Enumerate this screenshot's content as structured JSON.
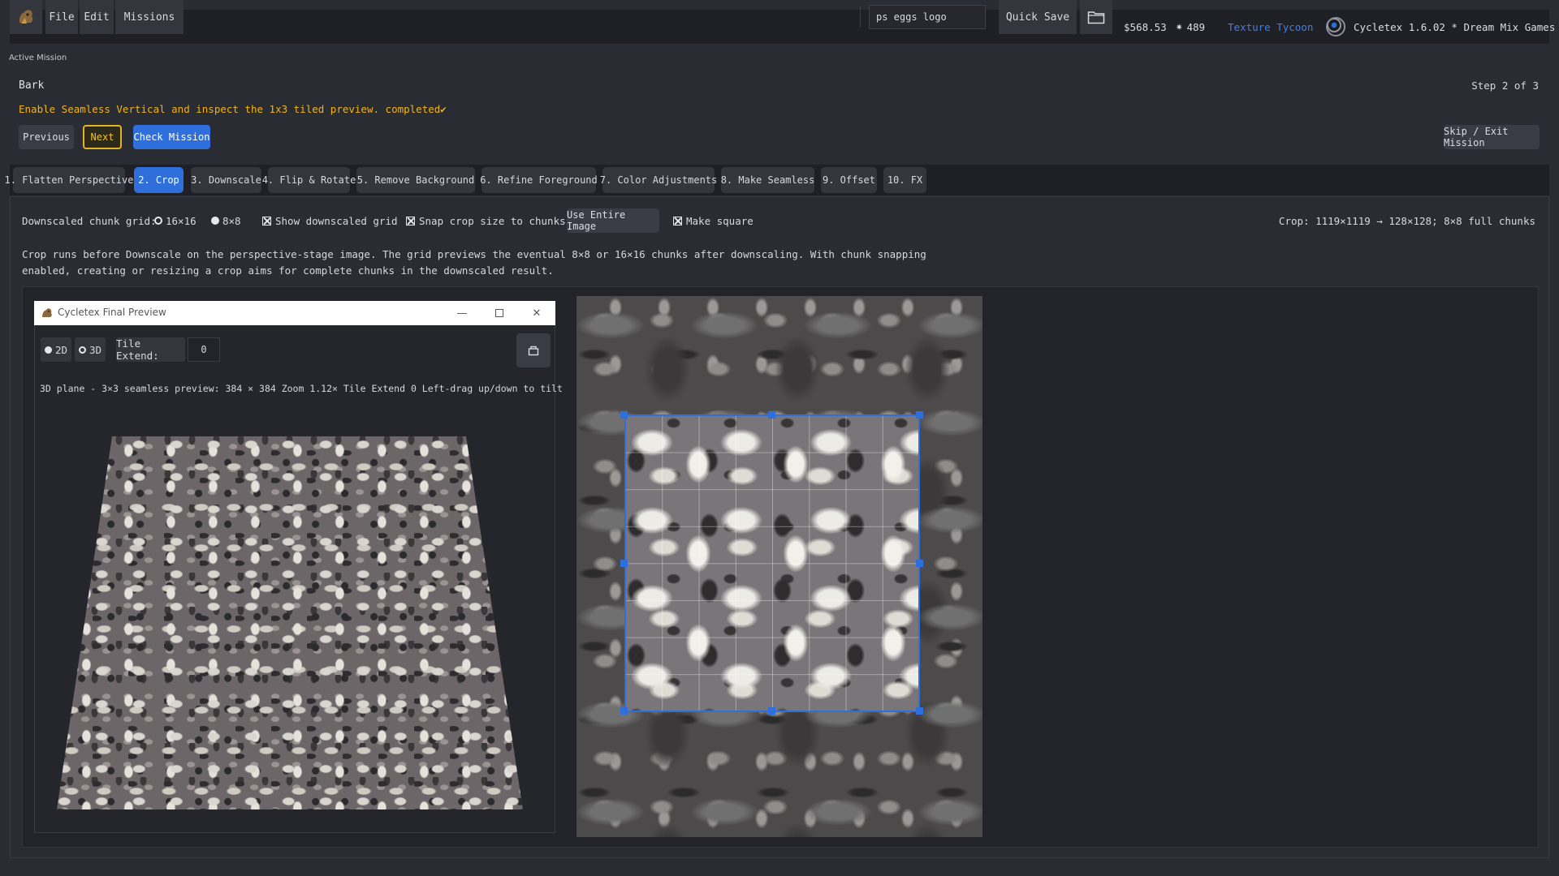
{
  "app": {
    "menu": [
      "File",
      "Edit",
      "Missions"
    ],
    "search_value": "ps eggs logo",
    "quick_save": "Quick Save",
    "money": "$568.53",
    "gems": "489",
    "mode_link": "Texture Tycoon",
    "version": "Cycletex 1.6.02 * Dream Mix Games"
  },
  "mission": {
    "section_label": "Active Mission",
    "name": "Bark",
    "step": "Step 2 of 3",
    "instruction": "Enable Seamless Vertical and inspect the 1x3 tiled preview. completed✔",
    "prev_label": "Previous",
    "next_label": "Next",
    "check_label": "Check Mission",
    "skip_label": "Skip / Exit Mission"
  },
  "tabs": [
    {
      "label": "1. Flatten Perspective",
      "active": false
    },
    {
      "label": "2. Crop",
      "active": true
    },
    {
      "label": "3. Downscale",
      "active": false
    },
    {
      "label": "4. Flip & Rotate",
      "active": false
    },
    {
      "label": "5. Remove Background",
      "active": false
    },
    {
      "label": "6. Refine Foreground",
      "active": false
    },
    {
      "label": "7. Color Adjustments",
      "active": false
    },
    {
      "label": "8. Make Seamless",
      "active": false
    },
    {
      "label": "9. Offset",
      "active": false
    },
    {
      "label": "10. FX",
      "active": false
    }
  ],
  "crop_options": {
    "grid_label": "Downscaled chunk grid:",
    "grid_opt_16": "16×16",
    "grid_opt_8": "8×8",
    "selected_grid": "8×8",
    "show_grid_label": "Show downscaled grid",
    "show_grid_checked": true,
    "snap_label": "Snap crop size to chunks",
    "snap_checked": true,
    "use_entire_label": "Use Entire Image",
    "make_square_label": "Make square",
    "make_square_checked": true,
    "crop_info": "Crop: 1119×1119 → 128×128; 8×8 full chunks"
  },
  "description": {
    "line1": "Crop runs before Downscale on the perspective-stage image. The grid previews the eventual 8×8 or 16×16 chunks after downscaling. With chunk snapping",
    "line2": "enabled, creating or resizing a crop aims for complete chunks in the downscaled result."
  },
  "preview_window": {
    "title": "Cycletex Final Preview",
    "mode_2d": "2D",
    "mode_3d": "3D",
    "selected_mode": "2D",
    "tile_extend_label": "Tile Extend:",
    "tile_extend_value": "0",
    "status": "3D plane - 3×3 seamless preview: 384 × 384   Zoom 1.12×   Tile Extend 0   Left-drag up/down to tilt"
  },
  "colors": {
    "accent": "#2f6fdc",
    "mission_text": "#f2b316",
    "next_border": "#e2b520",
    "link": "#3d7fe6"
  }
}
